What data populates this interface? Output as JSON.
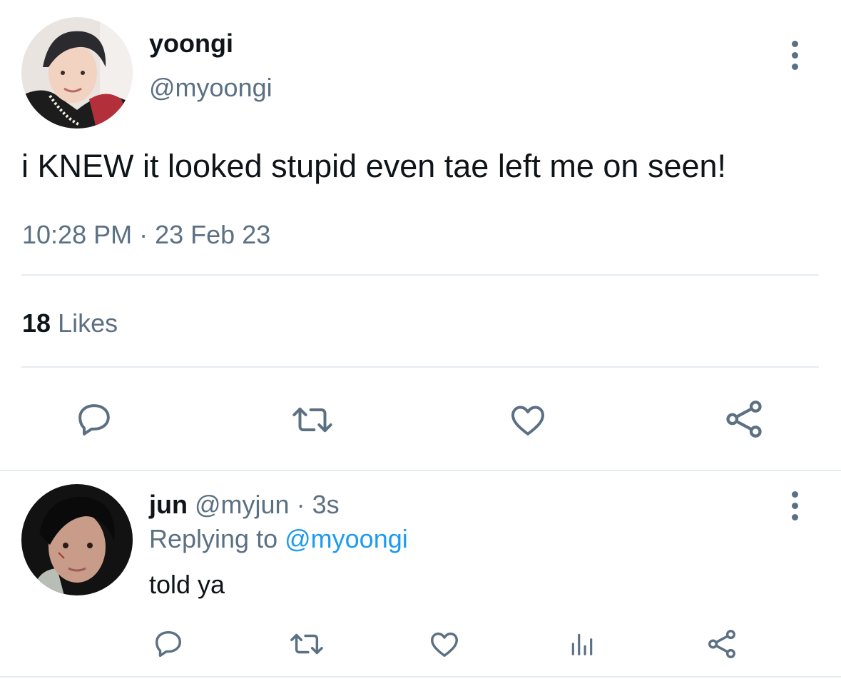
{
  "tweet": {
    "author": {
      "name": "yoongi",
      "handle": "@myoongi"
    },
    "text": "i KNEW it looked stupid even tae left me on seen!",
    "time": "10:28 PM",
    "separator": "·",
    "date": "23 Feb 23",
    "likes": {
      "count": "18",
      "label": "Likes"
    },
    "actions": [
      "reply-icon",
      "retweet-icon",
      "like-icon",
      "share-icon"
    ]
  },
  "reply": {
    "author": {
      "name": "jun",
      "handle": "@myjun"
    },
    "separator": "·",
    "age": "3s",
    "replying_prefix": "Replying to",
    "replying_to": "@myoongi",
    "text": "told ya",
    "actions": [
      "reply-icon",
      "retweet-icon",
      "like-icon",
      "analytics-icon",
      "share-icon"
    ]
  },
  "colors": {
    "muted": "#5b7083",
    "link": "#1d9bf0",
    "text": "#0f1419",
    "divider": "#e6ecf0"
  }
}
